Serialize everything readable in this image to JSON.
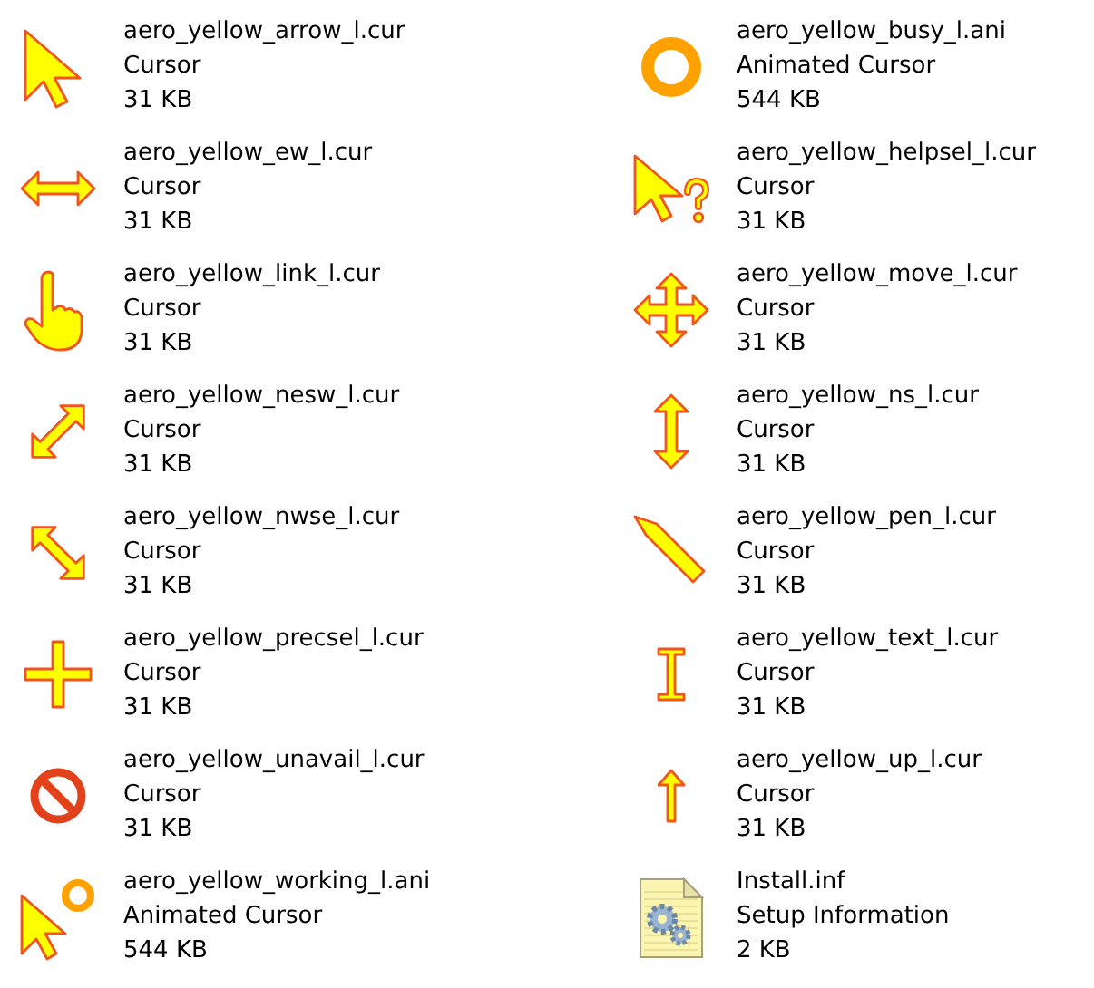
{
  "files": [
    {
      "kind": "arrow",
      "name": "aero_yellow_arrow_l.cur",
      "type": "Cursor",
      "size": "31 KB"
    },
    {
      "kind": "busy",
      "name": "aero_yellow_busy_l.ani",
      "type": "Animated Cursor",
      "size": "544 KB"
    },
    {
      "kind": "ew",
      "name": "aero_yellow_ew_l.cur",
      "type": "Cursor",
      "size": "31 KB"
    },
    {
      "kind": "helpsel",
      "name": "aero_yellow_helpsel_l.cur",
      "type": "Cursor",
      "size": "31 KB"
    },
    {
      "kind": "link",
      "name": "aero_yellow_link_l.cur",
      "type": "Cursor",
      "size": "31 KB"
    },
    {
      "kind": "move",
      "name": "aero_yellow_move_l.cur",
      "type": "Cursor",
      "size": "31 KB"
    },
    {
      "kind": "nesw",
      "name": "aero_yellow_nesw_l.cur",
      "type": "Cursor",
      "size": "31 KB"
    },
    {
      "kind": "ns",
      "name": "aero_yellow_ns_l.cur",
      "type": "Cursor",
      "size": "31 KB"
    },
    {
      "kind": "nwse",
      "name": "aero_yellow_nwse_l.cur",
      "type": "Cursor",
      "size": "31 KB"
    },
    {
      "kind": "pen",
      "name": "aero_yellow_pen_l.cur",
      "type": "Cursor",
      "size": "31 KB"
    },
    {
      "kind": "precsel",
      "name": "aero_yellow_precsel_l.cur",
      "type": "Cursor",
      "size": "31 KB"
    },
    {
      "kind": "text",
      "name": "aero_yellow_text_l.cur",
      "type": "Cursor",
      "size": "31 KB"
    },
    {
      "kind": "unavail",
      "name": "aero_yellow_unavail_l.cur",
      "type": "Cursor",
      "size": "31 KB"
    },
    {
      "kind": "up",
      "name": "aero_yellow_up_l.cur",
      "type": "Cursor",
      "size": "31 KB"
    },
    {
      "kind": "working",
      "name": "aero_yellow_working_l.ani",
      "type": "Animated Cursor",
      "size": "544 KB"
    },
    {
      "kind": "inf",
      "name": "Install.inf",
      "type": "Setup Information",
      "size": "2 KB"
    }
  ]
}
